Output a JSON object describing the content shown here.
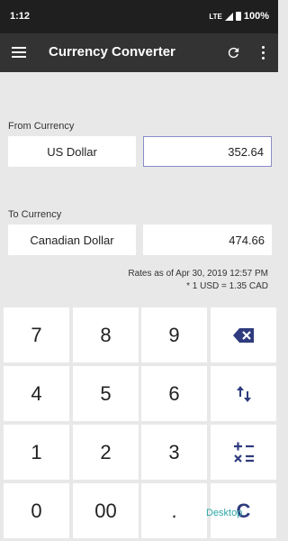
{
  "status": {
    "time": "1:12",
    "network": "LTE",
    "battery": "100%"
  },
  "app_bar": {
    "title": "Currency Converter"
  },
  "from": {
    "label": "From Currency",
    "currency": "US Dollar",
    "amount": "352.64"
  },
  "to": {
    "label": "To Currency",
    "currency": "Canadian Dollar",
    "amount": "474.66"
  },
  "rates": {
    "date_line": "Rates as of Apr 30, 2019 12:57 PM",
    "rate_line": "* 1 USD = 1.35 CAD"
  },
  "keypad": {
    "k7": "7",
    "k8": "8",
    "k9": "9",
    "k4": "4",
    "k5": "5",
    "k6": "6",
    "k1": "1",
    "k2": "2",
    "k3": "3",
    "k0": "0",
    "k00": "00",
    "kdot": ".",
    "clear": "C"
  },
  "watermark": "Desktop",
  "colors": {
    "app_bar": "#333333",
    "accent": "#2f3b7e",
    "background": "#e8e8e8"
  }
}
